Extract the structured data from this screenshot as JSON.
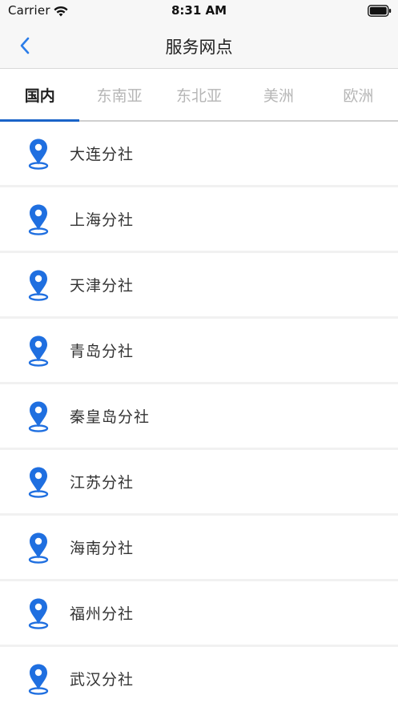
{
  "status_bar": {
    "carrier": "Carrier",
    "time": "8:31 AM",
    "icons": [
      "wifi-icon",
      "battery-icon"
    ]
  },
  "nav": {
    "title": "服务网点",
    "back_icon": "chevron-left-icon"
  },
  "tabs": [
    {
      "label": "国内",
      "active": true
    },
    {
      "label": "东南亚",
      "active": false
    },
    {
      "label": "东北亚",
      "active": false
    },
    {
      "label": "美洲",
      "active": false
    },
    {
      "label": "欧洲",
      "active": false
    }
  ],
  "branches": [
    {
      "name": "大连分社"
    },
    {
      "name": "上海分社"
    },
    {
      "name": "天津分社"
    },
    {
      "name": "青岛分社"
    },
    {
      "name": "秦皇岛分社"
    },
    {
      "name": "江苏分社"
    },
    {
      "name": "海南分社"
    },
    {
      "name": "福州分社"
    },
    {
      "name": "武汉分社"
    }
  ],
  "colors": {
    "accent": "#1a64c8",
    "pin": "#1f6fe0",
    "back": "#2b7de9",
    "inactive_tab": "#b6b6b6"
  }
}
